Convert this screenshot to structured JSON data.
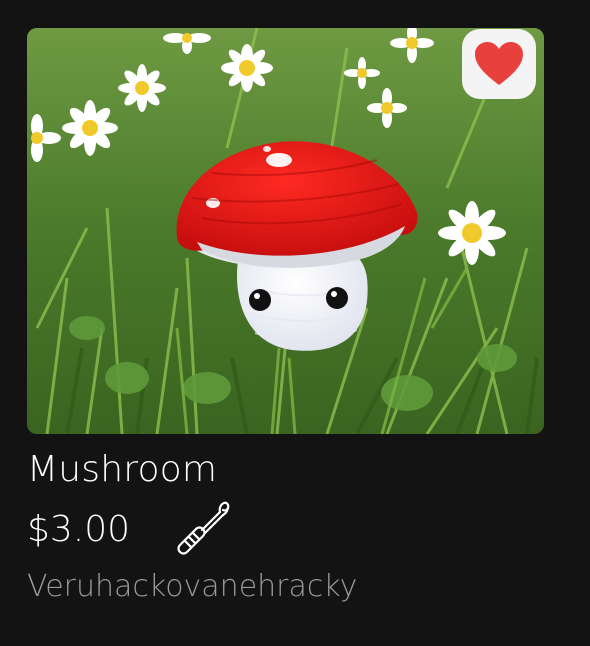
{
  "listing": {
    "title": "Mushroom",
    "price": "$3.00",
    "seller": "Veruhackovanehracky",
    "favorite_icon": "heart-icon",
    "category_icon": "crochet-hook-icon",
    "favorited": true
  },
  "colors": {
    "background": "#131313",
    "heart": "#e8413d",
    "seller_text": "#9a9a9a"
  }
}
